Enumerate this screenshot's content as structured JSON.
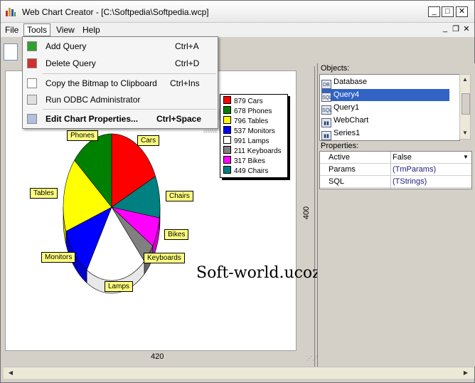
{
  "window": {
    "title": "Web Chart Creator - [C:\\Softpedia\\Softpedia.wcp]"
  },
  "menu": {
    "file": "File",
    "tools": "Tools",
    "view": "View",
    "help": "Help"
  },
  "tools_menu": {
    "add_query": "Add Query",
    "add_query_key": "Ctrl+A",
    "delete_query": "Delete Query",
    "delete_query_key": "Ctrl+D",
    "copy_bitmap": "Copy the Bitmap to Clipboard",
    "copy_bitmap_key": "Ctrl+Ins",
    "run_odbc": "Run ODBC Administrator",
    "edit_props": "Edit Chart Properties...",
    "edit_props_key": "Ctrl+Space"
  },
  "canvas": {
    "width_label": "420",
    "height_label": "400"
  },
  "watermark": "Soft-world.ucoz.net",
  "chart_data": {
    "type": "pie",
    "categories": [
      "Cars",
      "Phones",
      "Tables",
      "Monitors",
      "Lamps",
      "Keyboards",
      "Bikes",
      "Chairs"
    ],
    "values": [
      879,
      678,
      796,
      537,
      991,
      211,
      317,
      449
    ],
    "colors": [
      "#ff0000",
      "#008000",
      "#ffff00",
      "#0000ff",
      "#ffffff",
      "#808080",
      "#ff00ff",
      "#008080"
    ],
    "legend": [
      "879 Cars",
      "678 Phones",
      "796 Tables",
      "537 Monitors",
      "991 Lamps",
      "211 Keyboards",
      "317 Bikes",
      "449 Chairs"
    ],
    "legend_position": "top-right",
    "three_d": true
  },
  "panel": {
    "objects_label": "Objects:",
    "objects": [
      "Database",
      "Query4",
      "Query1",
      "WebChart",
      "Series1"
    ],
    "selected_object": "Query4",
    "properties_label": "Properties:",
    "properties": [
      {
        "name": "Active",
        "value": "False"
      },
      {
        "name": "Params",
        "value": "(TmParams)"
      },
      {
        "name": "SQL",
        "value": "(TStrings)"
      }
    ]
  }
}
